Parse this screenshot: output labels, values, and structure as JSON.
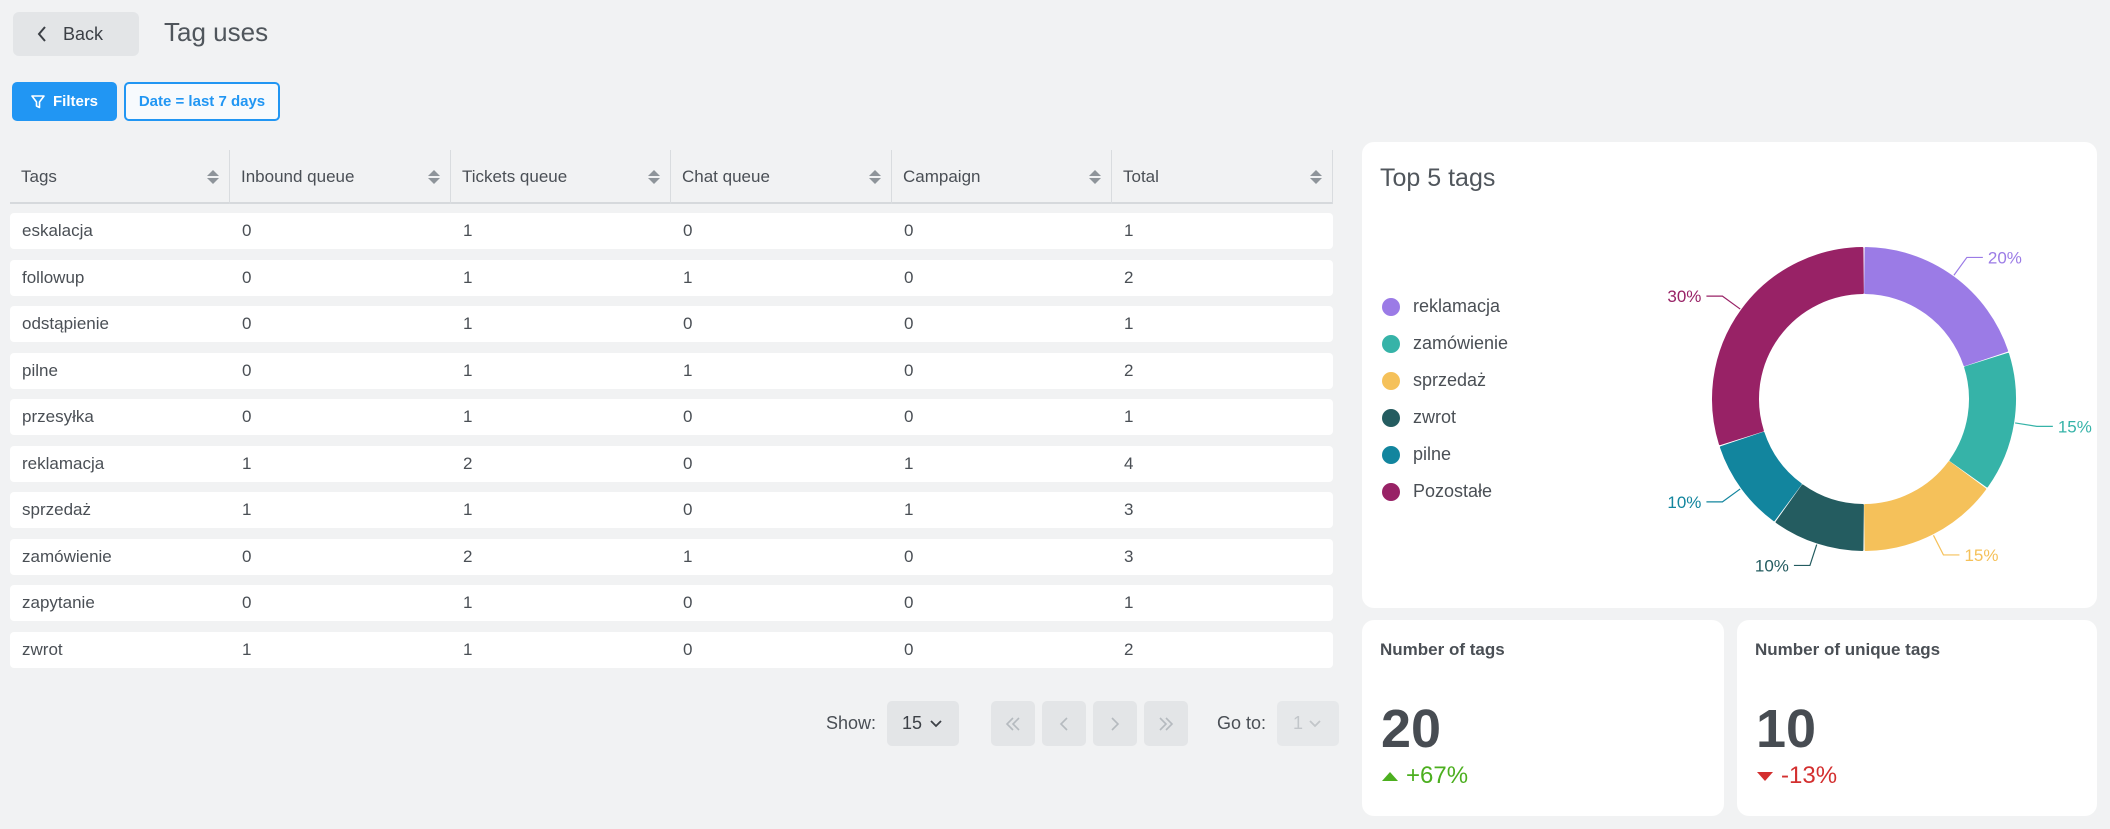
{
  "header": {
    "back_label": "Back",
    "title": "Tag uses"
  },
  "filters": {
    "filters_label": "Filters",
    "date_chip": "Date = last 7 days"
  },
  "table": {
    "columns": [
      "Tags",
      "Inbound queue",
      "Tickets queue",
      "Chat queue",
      "Campaign",
      "Total"
    ],
    "rows": [
      [
        "eskalacja",
        "0",
        "1",
        "0",
        "0",
        "1"
      ],
      [
        "followup",
        "0",
        "1",
        "1",
        "0",
        "2"
      ],
      [
        "odstąpienie",
        "0",
        "1",
        "0",
        "0",
        "1"
      ],
      [
        "pilne",
        "0",
        "1",
        "1",
        "0",
        "2"
      ],
      [
        "przesyłka",
        "0",
        "1",
        "0",
        "0",
        "1"
      ],
      [
        "reklamacja",
        "1",
        "2",
        "0",
        "1",
        "4"
      ],
      [
        "sprzedaż",
        "1",
        "1",
        "0",
        "1",
        "3"
      ],
      [
        "zamówienie",
        "0",
        "2",
        "1",
        "0",
        "3"
      ],
      [
        "zapytanie",
        "0",
        "1",
        "0",
        "0",
        "1"
      ],
      [
        "zwrot",
        "1",
        "1",
        "0",
        "0",
        "2"
      ]
    ]
  },
  "pagination": {
    "show_label": "Show:",
    "page_size": "15",
    "goto_label": "Go to:",
    "page": "1"
  },
  "chart_data": {
    "type": "pie",
    "title": "Top 5 tags",
    "categories": [
      "reklamacja",
      "zamówienie",
      "sprzedaż",
      "zwrot",
      "pilne",
      "Pozostałe"
    ],
    "values": [
      20,
      15,
      15,
      10,
      10,
      30
    ],
    "labels": [
      "20%",
      "15%",
      "15%",
      "10%",
      "10%",
      "30%"
    ],
    "colors": [
      "#9b7be6",
      "#36b3a8",
      "#f5c15a",
      "#245c60",
      "#12859e",
      "#982266"
    ],
    "donut": true,
    "legend": "left"
  },
  "stats": [
    {
      "title": "Number of tags",
      "value": "20",
      "change": "+67%",
      "direction": "up",
      "color": "#4caf1f"
    },
    {
      "title": "Number of unique tags",
      "value": "10",
      "change": "-13%",
      "direction": "down",
      "color": "#d32f2f"
    }
  ]
}
